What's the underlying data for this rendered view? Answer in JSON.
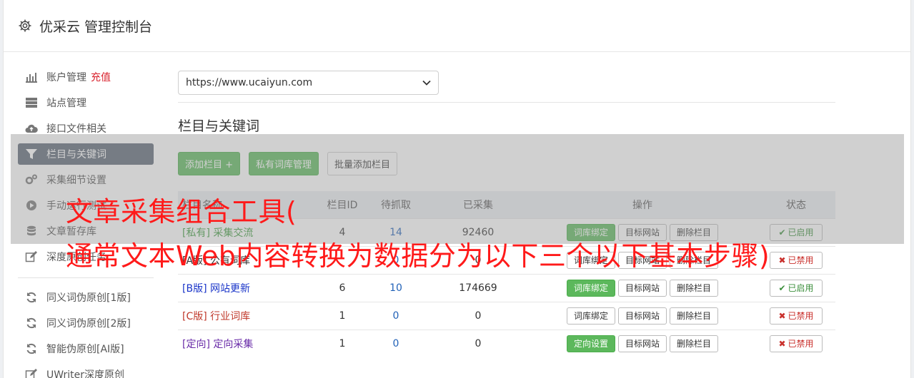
{
  "header": {
    "title": "优采云 管理控制台",
    "icon": "gear-icon"
  },
  "sidebar": {
    "group1": [
      {
        "label": "账户管理",
        "extra": "充值",
        "icon": "bar-chart-icon",
        "active": false
      },
      {
        "label": "站点管理",
        "icon": "server-icon",
        "active": false
      },
      {
        "label": "接口文件相关",
        "icon": "cloud-upload-icon",
        "active": false
      },
      {
        "label": "栏目与关键词",
        "icon": "filter-icon",
        "active": true
      },
      {
        "label": "采集细节设置",
        "icon": "cogs-icon",
        "active": false
      },
      {
        "label": "手动运行测试",
        "icon": "play-icon",
        "active": false
      },
      {
        "label": "文章暂存库",
        "icon": "database-icon",
        "active": false
      },
      {
        "label": "深度原创任务",
        "icon": "edit-icon",
        "active": false
      }
    ],
    "group2": [
      {
        "label": "同义词伪原创[1版]",
        "icon": "refresh-icon"
      },
      {
        "label": "同义词伪原创[2版]",
        "icon": "refresh-icon"
      },
      {
        "label": "智能伪原创[AI版]",
        "icon": "refresh-icon"
      },
      {
        "label": "UWriter深度原创",
        "icon": "edit-icon"
      }
    ]
  },
  "main": {
    "site_select_value": "https://www.ucaiyun.com",
    "section_title": "栏目与关键词",
    "buttons": {
      "add": "添加栏目 +",
      "private": "私有词库管理",
      "batch": "批量添加栏目"
    },
    "table": {
      "headers": {
        "name": "栏目名称",
        "id": "栏目ID",
        "pending": "待抓取",
        "collected": "已采集",
        "ops": "操作",
        "status": "状态"
      },
      "rows": [
        {
          "tag": "[私有]",
          "name": "采集交流",
          "tag_color": "green",
          "id": "4",
          "pending": "14",
          "collected": "92460",
          "op1": "词库绑定",
          "op1_green": true,
          "op2": "目标网站",
          "op3": "删除栏目",
          "status": "已启用",
          "enabled": true
        },
        {
          "tag": "[A版]",
          "name": "公有词库",
          "tag_color": "dark",
          "id": "",
          "pending": "0",
          "collected": "0",
          "op1": "词库绑定",
          "op1_green": false,
          "op2": "目标网站",
          "op3": "删除栏目",
          "status": "已禁用",
          "enabled": false
        },
        {
          "tag": "[B版]",
          "name": "网站更新",
          "tag_color": "blue",
          "id": "6",
          "pending": "10",
          "collected": "174669",
          "op1": "词库绑定",
          "op1_green": true,
          "op2": "目标网站",
          "op3": "删除栏目",
          "status": "已启用",
          "enabled": true
        },
        {
          "tag": "[C版]",
          "name": "行业词库",
          "tag_color": "red",
          "id": "1",
          "pending": "0",
          "collected": "0",
          "op1": "词库绑定",
          "op1_green": false,
          "op2": "目标网站",
          "op3": "删除栏目",
          "status": "已禁用",
          "enabled": false
        },
        {
          "tag": "[定向]",
          "name": "定向采集",
          "tag_color": "purple",
          "id": "1",
          "pending": "0",
          "collected": "0",
          "op1": "定向设置",
          "op1_green": true,
          "op2": "目标网站",
          "op3": "删除栏目",
          "status": "已禁用",
          "enabled": false
        }
      ]
    }
  },
  "watermark": {
    "line1": "文章采集组合工具(",
    "line2": "通常文本Web内容转换为数据分为以下三个以下基本步骤)"
  },
  "colors": {
    "green": "#5cb85c",
    "sidebar_active": "#5b6675",
    "watermark": "#ff1a1a"
  }
}
